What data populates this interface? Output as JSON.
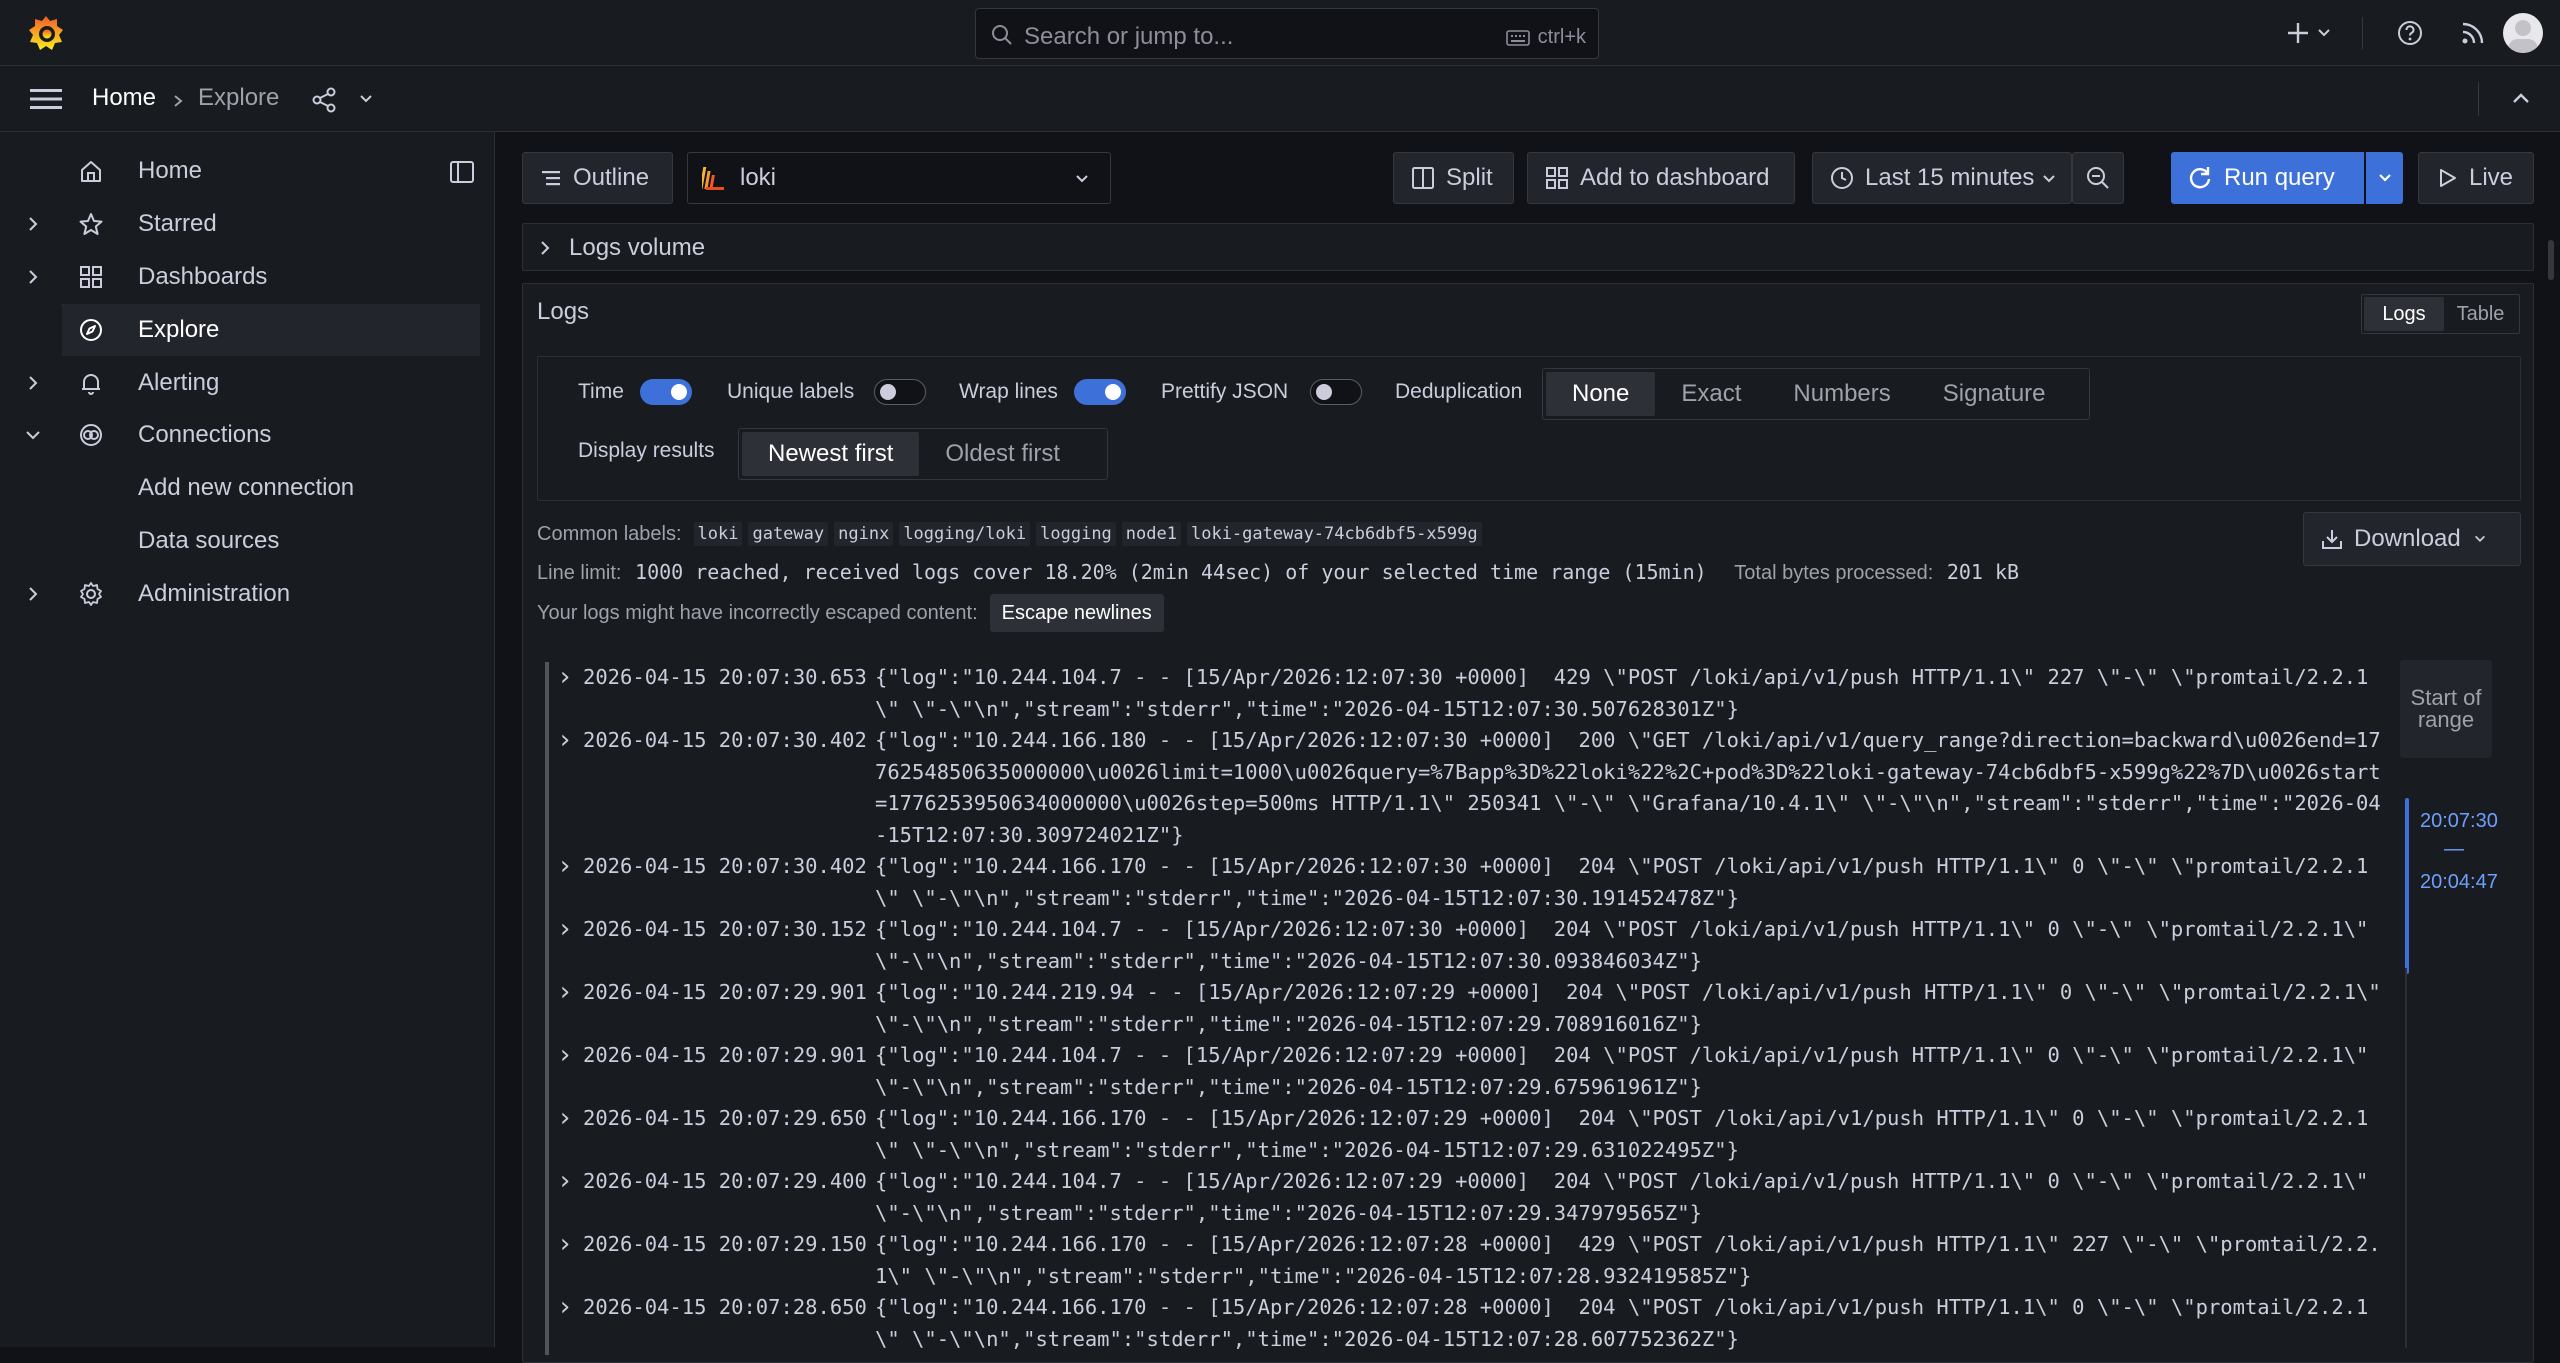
{
  "topbar": {
    "search_placeholder": "Search or jump to...",
    "search_shortcut": "ctrl+k"
  },
  "breadcrumb": {
    "home": "Home",
    "current": "Explore"
  },
  "sidebar": {
    "items": [
      {
        "label": "Home",
        "icon": "home-icon",
        "expandable": false
      },
      {
        "label": "Starred",
        "icon": "star-icon",
        "expandable": true
      },
      {
        "label": "Dashboards",
        "icon": "dashboards-icon",
        "expandable": true
      },
      {
        "label": "Explore",
        "icon": "compass-icon",
        "expandable": false,
        "active": true
      },
      {
        "label": "Alerting",
        "icon": "bell-icon",
        "expandable": true
      },
      {
        "label": "Connections",
        "icon": "connections-icon",
        "expandable": true,
        "expanded": true
      },
      {
        "label": "Add new connection",
        "icon": "",
        "sub": true
      },
      {
        "label": "Data sources",
        "icon": "",
        "sub": true
      },
      {
        "label": "Administration",
        "icon": "gear-icon",
        "expandable": true
      }
    ]
  },
  "toolbar": {
    "outline": "Outline",
    "datasource": "loki",
    "split": "Split",
    "add_to_dashboard": "Add to dashboard",
    "time_range": "Last 15 minutes",
    "run_query": "Run query",
    "live": "Live"
  },
  "logs_volume": {
    "title": "Logs volume"
  },
  "logs": {
    "title": "Logs",
    "view_options": [
      "Logs",
      "Table"
    ],
    "selected_view": "Logs",
    "options": {
      "time_label": "Time",
      "time_on": true,
      "unique_labels_label": "Unique labels",
      "unique_labels_on": false,
      "wrap_lines_label": "Wrap lines",
      "wrap_lines_on": true,
      "prettify_json_label": "Prettify JSON",
      "prettify_json_on": false,
      "dedup_label": "Deduplication",
      "dedup_options": [
        "None",
        "Exact",
        "Numbers",
        "Signature"
      ],
      "dedup_selected": "None",
      "display_results_label": "Display results",
      "order_options": [
        "Newest first",
        "Oldest first"
      ],
      "order_selected": "Newest first"
    },
    "common_labels_title": "Common labels:",
    "common_labels": [
      "loki",
      "gateway",
      "nginx",
      "logging/loki",
      "logging",
      "node1",
      "loki-gateway-74cb6dbf5-x599g"
    ],
    "line_limit_title": "Line limit:",
    "line_limit_value": "1000 reached, received logs cover 18.20% (2min 44sec) of your selected time range (15min)",
    "bytes_title": "Total bytes processed:",
    "bytes_value": "201 kB",
    "escape_warning": "Your logs might have incorrectly escaped content:",
    "escape_button": "Escape newlines",
    "download": "Download",
    "range_start": "Start of range",
    "range_top": "20:07:30",
    "range_sep": "—",
    "range_bottom": "20:04:47",
    "rows": [
      {
        "ts": "2026-04-15 20:07:30.653",
        "msg": "{\"log\":\"10.244.104.7 - - [15/Apr/2026:12:07:30 +0000]  429 \\\"POST /loki/api/v1/push HTTP/1.1\\\" 227 \\\"-\\\" \\\"promtail/2.2.1\\\" \\\"-\\\"\\n\",\"stream\":\"stderr\",\"time\":\"2026-04-15T12:07:30.507628301Z\"}"
      },
      {
        "ts": "2026-04-15 20:07:30.402",
        "msg": "{\"log\":\"10.244.166.180 - - [15/Apr/2026:12:07:30 +0000]  200 \\\"GET /loki/api/v1/query_range?direction=backward\\u0026end=1776254850635000000\\u0026limit=1000\\u0026query=%7Bapp%3D%22loki%22%2C+pod%3D%22loki-gateway-74cb6dbf5-x599g%22%7D\\u0026start=1776253950634000000\\u0026step=500ms HTTP/1.1\\\" 250341 \\\"-\\\" \\\"Grafana/10.4.1\\\" \\\"-\\\"\\n\",\"stream\":\"stderr\",\"time\":\"2026-04-15T12:07:30.309724021Z\"}"
      },
      {
        "ts": "2026-04-15 20:07:30.402",
        "msg": "{\"log\":\"10.244.166.170 - - [15/Apr/2026:12:07:30 +0000]  204 \\\"POST /loki/api/v1/push HTTP/1.1\\\" 0 \\\"-\\\" \\\"promtail/2.2.1\\\" \\\"-\\\"\\n\",\"stream\":\"stderr\",\"time\":\"2026-04-15T12:07:30.191452478Z\"}"
      },
      {
        "ts": "2026-04-15 20:07:30.152",
        "msg": "{\"log\":\"10.244.104.7 - - [15/Apr/2026:12:07:30 +0000]  204 \\\"POST /loki/api/v1/push HTTP/1.1\\\" 0 \\\"-\\\" \\\"promtail/2.2.1\\\" \\\"-\\\"\\n\",\"stream\":\"stderr\",\"time\":\"2026-04-15T12:07:30.093846034Z\"}"
      },
      {
        "ts": "2026-04-15 20:07:29.901",
        "msg": "{\"log\":\"10.244.219.94 - - [15/Apr/2026:12:07:29 +0000]  204 \\\"POST /loki/api/v1/push HTTP/1.1\\\" 0 \\\"-\\\" \\\"promtail/2.2.1\\\" \\\"-\\\"\\n\",\"stream\":\"stderr\",\"time\":\"2026-04-15T12:07:29.708916016Z\"}"
      },
      {
        "ts": "2026-04-15 20:07:29.901",
        "msg": "{\"log\":\"10.244.104.7 - - [15/Apr/2026:12:07:29 +0000]  204 \\\"POST /loki/api/v1/push HTTP/1.1\\\" 0 \\\"-\\\" \\\"promtail/2.2.1\\\" \\\"-\\\"\\n\",\"stream\":\"stderr\",\"time\":\"2026-04-15T12:07:29.675961961Z\"}"
      },
      {
        "ts": "2026-04-15 20:07:29.650",
        "msg": "{\"log\":\"10.244.166.170 - - [15/Apr/2026:12:07:29 +0000]  204 \\\"POST /loki/api/v1/push HTTP/1.1\\\" 0 \\\"-\\\" \\\"promtail/2.2.1\\\" \\\"-\\\"\\n\",\"stream\":\"stderr\",\"time\":\"2026-04-15T12:07:29.631022495Z\"}"
      },
      {
        "ts": "2026-04-15 20:07:29.400",
        "msg": "{\"log\":\"10.244.104.7 - - [15/Apr/2026:12:07:29 +0000]  204 \\\"POST /loki/api/v1/push HTTP/1.1\\\" 0 \\\"-\\\" \\\"promtail/2.2.1\\\" \\\"-\\\"\\n\",\"stream\":\"stderr\",\"time\":\"2026-04-15T12:07:29.347979565Z\"}"
      },
      {
        "ts": "2026-04-15 20:07:29.150",
        "msg": "{\"log\":\"10.244.166.170 - - [15/Apr/2026:12:07:28 +0000]  429 \\\"POST /loki/api/v1/push HTTP/1.1\\\" 227 \\\"-\\\" \\\"promtail/2.2.1\\\" \\\"-\\\"\\n\",\"stream\":\"stderr\",\"time\":\"2026-04-15T12:07:28.932419585Z\"}"
      },
      {
        "ts": "2026-04-15 20:07:28.650",
        "msg": "{\"log\":\"10.244.166.170 - - [15/Apr/2026:12:07:28 +0000]  204 \\\"POST /loki/api/v1/push HTTP/1.1\\\" 0 \\\"-\\\" \\\"promtail/2.2.1\\\" \\\"-\\\"\\n\",\"stream\":\"stderr\",\"time\":\"2026-04-15T12:07:28.607752362Z\"}"
      }
    ]
  },
  "colors": {
    "accent": "#3d71d9",
    "brand": "#f55f3e",
    "background": "#111217",
    "panel": "#181b1f"
  }
}
